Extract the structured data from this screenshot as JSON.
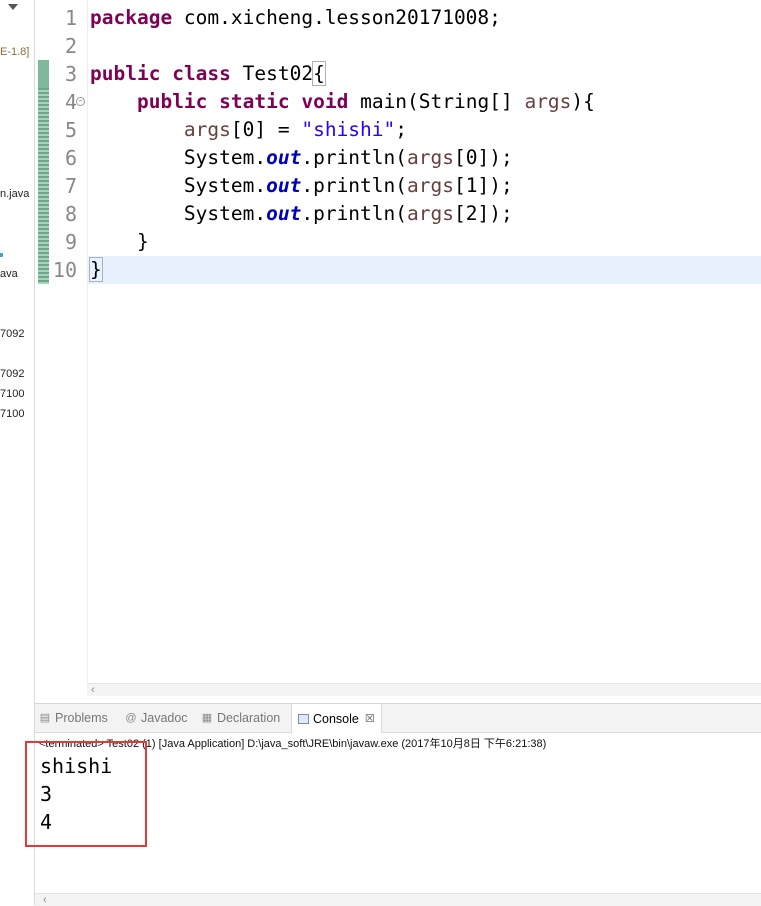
{
  "explorer": {
    "fragments": [
      "E-1.8]",
      "n.java",
      "ava",
      "7092",
      "7092",
      "7100",
      "7100"
    ]
  },
  "editor": {
    "line_numbers": [
      "1",
      "2",
      "3",
      "4",
      "5",
      "6",
      "7",
      "8",
      "9",
      "10"
    ],
    "code_lines": [
      [
        {
          "t": "package",
          "c": "kw"
        },
        {
          "t": " com.xicheng.lesson20171008;",
          "c": ""
        }
      ],
      [],
      [
        {
          "t": "public",
          "c": "kw"
        },
        {
          "t": " ",
          "c": ""
        },
        {
          "t": "class",
          "c": "kw"
        },
        {
          "t": " Test02",
          "c": ""
        },
        {
          "t": "{",
          "c": "brk"
        }
      ],
      [
        {
          "t": "    ",
          "c": ""
        },
        {
          "t": "public",
          "c": "kw"
        },
        {
          "t": " ",
          "c": ""
        },
        {
          "t": "static",
          "c": "kw"
        },
        {
          "t": " ",
          "c": ""
        },
        {
          "t": "void",
          "c": "kw"
        },
        {
          "t": " main(String[] ",
          "c": ""
        },
        {
          "t": "args",
          "c": "var"
        },
        {
          "t": "){",
          "c": ""
        }
      ],
      [
        {
          "t": "        ",
          "c": ""
        },
        {
          "t": "args",
          "c": "var"
        },
        {
          "t": "[0] = ",
          "c": ""
        },
        {
          "t": "\"shishi\"",
          "c": "str"
        },
        {
          "t": ";",
          "c": ""
        }
      ],
      [
        {
          "t": "        System.",
          "c": ""
        },
        {
          "t": "out",
          "c": "fld"
        },
        {
          "t": ".println(",
          "c": ""
        },
        {
          "t": "args",
          "c": "var"
        },
        {
          "t": "[0]);",
          "c": ""
        }
      ],
      [
        {
          "t": "        System.",
          "c": ""
        },
        {
          "t": "out",
          "c": "fld"
        },
        {
          "t": ".println(",
          "c": ""
        },
        {
          "t": "args",
          "c": "var"
        },
        {
          "t": "[1]);",
          "c": ""
        }
      ],
      [
        {
          "t": "        System.",
          "c": ""
        },
        {
          "t": "out",
          "c": "fld"
        },
        {
          "t": ".println(",
          "c": ""
        },
        {
          "t": "args",
          "c": "var"
        },
        {
          "t": "[2]);",
          "c": ""
        }
      ],
      [
        {
          "t": "    }",
          "c": ""
        }
      ],
      [
        {
          "t": "}",
          "c": "brk"
        }
      ]
    ],
    "current_line": 10,
    "fold_marker_line": 4,
    "scroll_arrow": "‹"
  },
  "console_panel": {
    "tabs": [
      {
        "label": "Problems",
        "icon": "problems-icon",
        "active": false
      },
      {
        "label": "Javadoc",
        "icon": "javadoc-icon",
        "active": false
      },
      {
        "label": "Declaration",
        "icon": "declaration-icon",
        "active": false
      },
      {
        "label": "Console",
        "icon": "console-icon",
        "active": true
      }
    ],
    "close_glyph": "☒",
    "status": "<terminated> Test02 (1) [Java Application] D:\\java_soft\\JRE\\bin\\javaw.exe (2017年10月8日 下午6:21:38)",
    "output": [
      "shishi",
      "3",
      "4"
    ],
    "scroll_arrow": "‹"
  },
  "colors": {
    "keyword": "#7f0055",
    "string": "#2a00ff",
    "field": "#0000c0",
    "variable": "#6a3e3e",
    "highlight_box": "#e53935"
  }
}
